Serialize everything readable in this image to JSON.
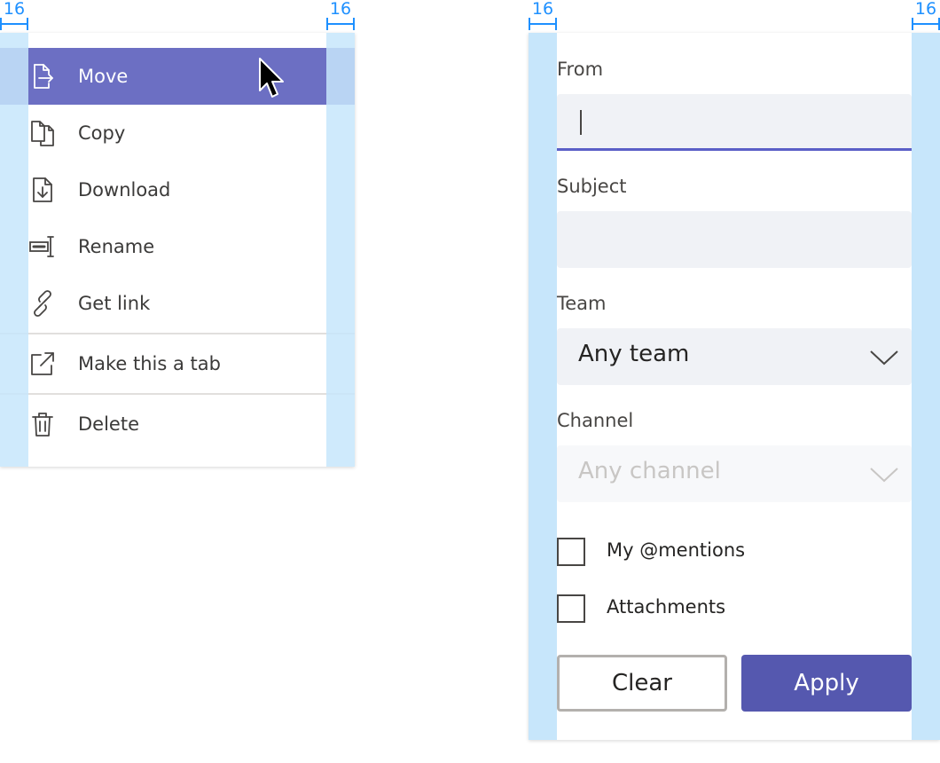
{
  "redline": {
    "spacing": "16"
  },
  "menu": {
    "items": [
      {
        "label": "Move",
        "icon": "move-file-icon",
        "selected": true
      },
      {
        "label": "Copy",
        "icon": "copy-icon"
      },
      {
        "label": "Download",
        "icon": "download-file-icon"
      },
      {
        "label": "Rename",
        "icon": "rename-icon"
      },
      {
        "label": "Get link",
        "icon": "link-icon"
      },
      {
        "label": "Make this a tab",
        "icon": "open-external-icon"
      },
      {
        "label": "Delete",
        "icon": "trash-icon"
      }
    ]
  },
  "filter": {
    "from_label": "From",
    "from_value": "",
    "subject_label": "Subject",
    "subject_value": "",
    "team_label": "Team",
    "team_value": "Any team",
    "channel_label": "Channel",
    "channel_value": "Any channel",
    "checkboxes": [
      {
        "label": "My @mentions",
        "checked": false
      },
      {
        "label": "Attachments",
        "checked": false
      }
    ],
    "clear_label": "Clear",
    "apply_label": "Apply"
  },
  "colors": {
    "accent": "#5b5fc7",
    "selected_item": "#6c6fc3",
    "redline": "#1e90ff",
    "padding_band": "#c7e6fb"
  }
}
